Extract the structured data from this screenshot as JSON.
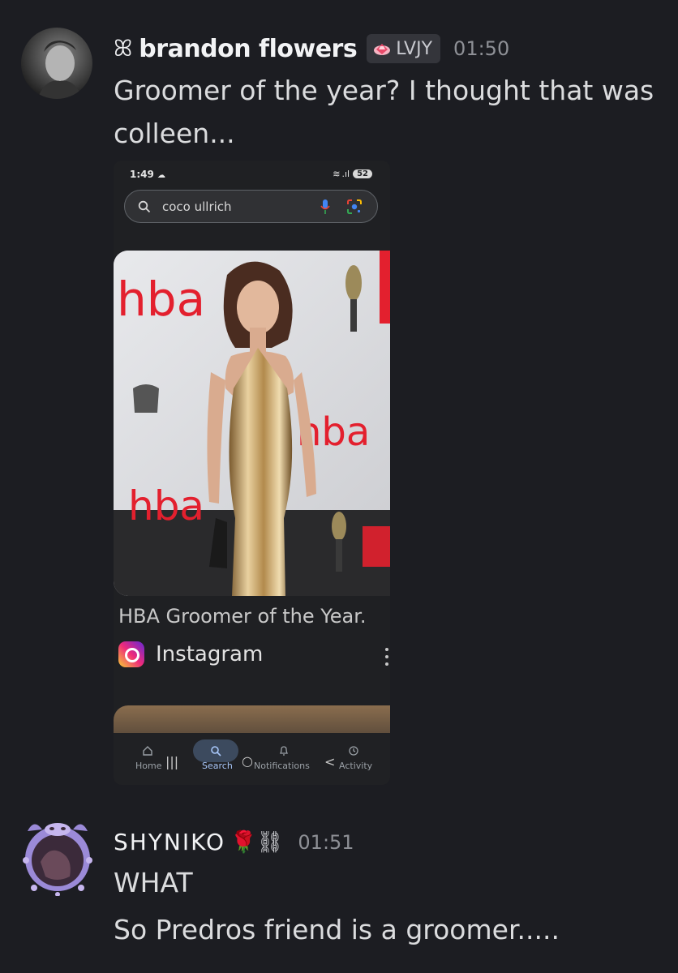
{
  "messages": [
    {
      "author": "brandon flowers",
      "symbol": "ꕤ",
      "tag": "LVJY",
      "time": "01:50",
      "lines": [
        "Groomer of the year? I thought that was",
        "colleen..."
      ],
      "attachment": {
        "status_time": "1:49",
        "battery": "52",
        "search_query": "coco ullrich",
        "caption": "HBA Groomer of the Year.",
        "source": "Instagram",
        "photo_text": [
          "hba",
          "hba",
          "hba"
        ],
        "nav": [
          {
            "icon": "home-icon",
            "label": "Home"
          },
          {
            "icon": "search-icon",
            "label": "Search"
          },
          {
            "icon": "bell-icon",
            "label": "Notifications"
          },
          {
            "icon": "activity-icon",
            "label": "Activity"
          }
        ],
        "sys_buttons": [
          "|||",
          "○",
          "<"
        ]
      }
    },
    {
      "author": "SHYNIKO",
      "author_suffix": "🌹⛓",
      "time": "01:51",
      "lines": [
        "WHAT",
        "So Predros friend is a groomer....."
      ]
    }
  ],
  "colors": {
    "background": "#1c1d22",
    "username": "#f2f3f5",
    "text": "#dbdcde",
    "timestamp": "#8e9096",
    "tag_bg": "#34353b"
  }
}
